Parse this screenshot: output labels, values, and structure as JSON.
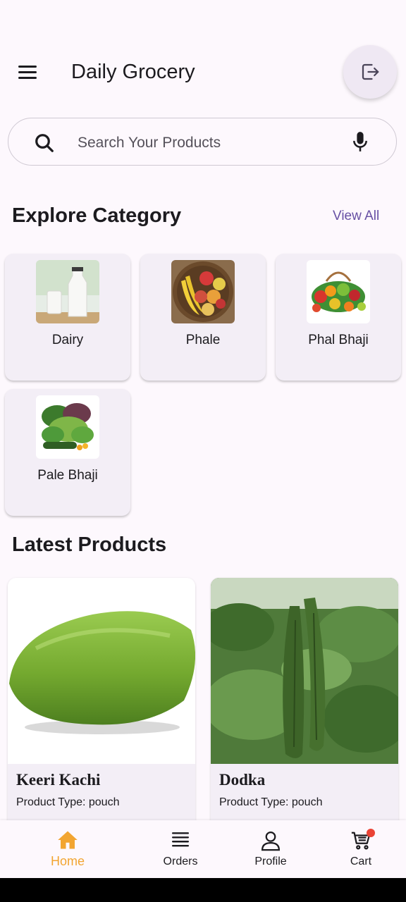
{
  "app_bar": {
    "title": "Daily Grocery",
    "menu_icon": "menu-icon",
    "logout_icon": "logout-icon"
  },
  "search": {
    "placeholder": "Search Your Products",
    "value": ""
  },
  "categories_section": {
    "title": "Explore Category",
    "view_all": "View All",
    "items": [
      {
        "label": "Dairy"
      },
      {
        "label": "Phale"
      },
      {
        "label": "Phal Bhaji"
      },
      {
        "label": "Pale Bhaji"
      }
    ]
  },
  "latest_section": {
    "title": "Latest Products",
    "products": [
      {
        "name": "Keeri Kachi",
        "type": "Product Type: pouch"
      },
      {
        "name": "Dodka",
        "type": "Product Type: pouch"
      }
    ]
  },
  "bottom_nav": {
    "items": [
      {
        "label": "Home",
        "icon": "home-icon",
        "active": true
      },
      {
        "label": "Orders",
        "icon": "orders-icon"
      },
      {
        "label": "Profile",
        "icon": "profile-icon"
      },
      {
        "label": "Cart",
        "icon": "cart-icon"
      }
    ]
  },
  "colors": {
    "accent": "#6750a4",
    "active_nav": "#f2a531",
    "background": "#fdf8fd",
    "card": "#f3eef6",
    "badge": "#ea4335"
  }
}
